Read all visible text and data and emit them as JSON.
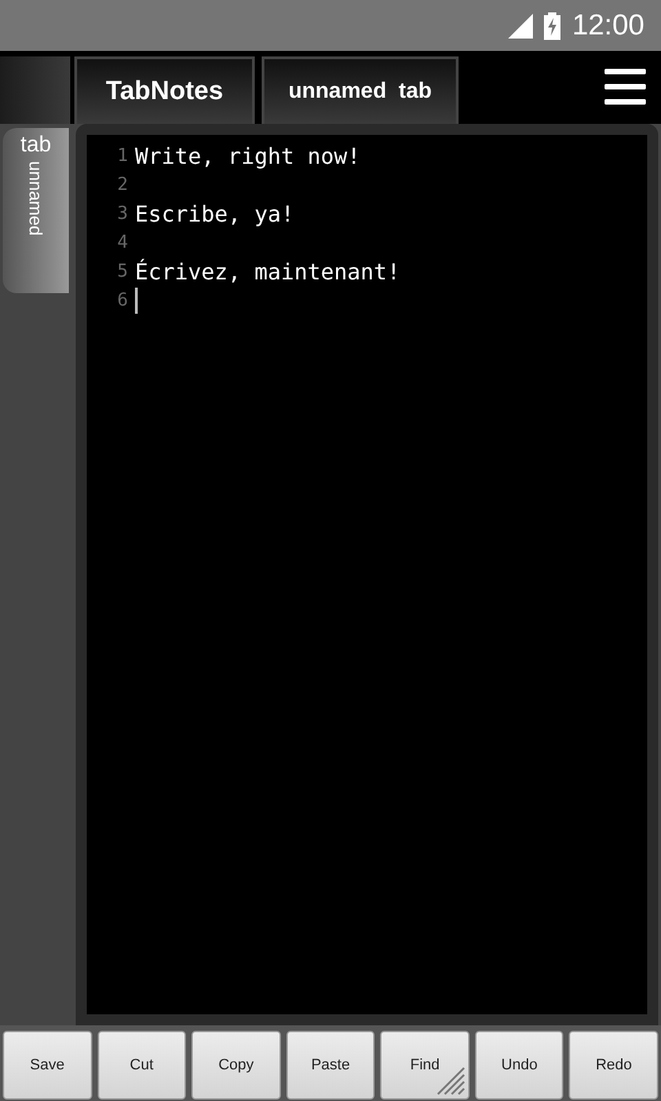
{
  "status_bar": {
    "time": "12:00"
  },
  "tabs": [
    {
      "label": "TabNotes"
    },
    {
      "label": "unnamed  tab"
    }
  ],
  "side_tab": {
    "title": "tab",
    "subtitle": "unnamed"
  },
  "editor": {
    "lines": [
      {
        "number": "1",
        "text": "Write, right now!"
      },
      {
        "number": "2"
      },
      {
        "number": "3",
        "text": "Escribe, ya!"
      },
      {
        "number": "4"
      },
      {
        "number": "5",
        "text": "Écrivez, maintenant!"
      },
      {
        "number": "6",
        "cursor": true
      }
    ]
  },
  "buttons": [
    {
      "label": "Save",
      "more": false
    },
    {
      "label": "Cut",
      "more": false
    },
    {
      "label": "Copy",
      "more": false
    },
    {
      "label": "Paste",
      "more": false
    },
    {
      "label": "Find",
      "more": true
    },
    {
      "label": "Undo",
      "more": false
    },
    {
      "label": "Redo",
      "more": false
    }
  ]
}
